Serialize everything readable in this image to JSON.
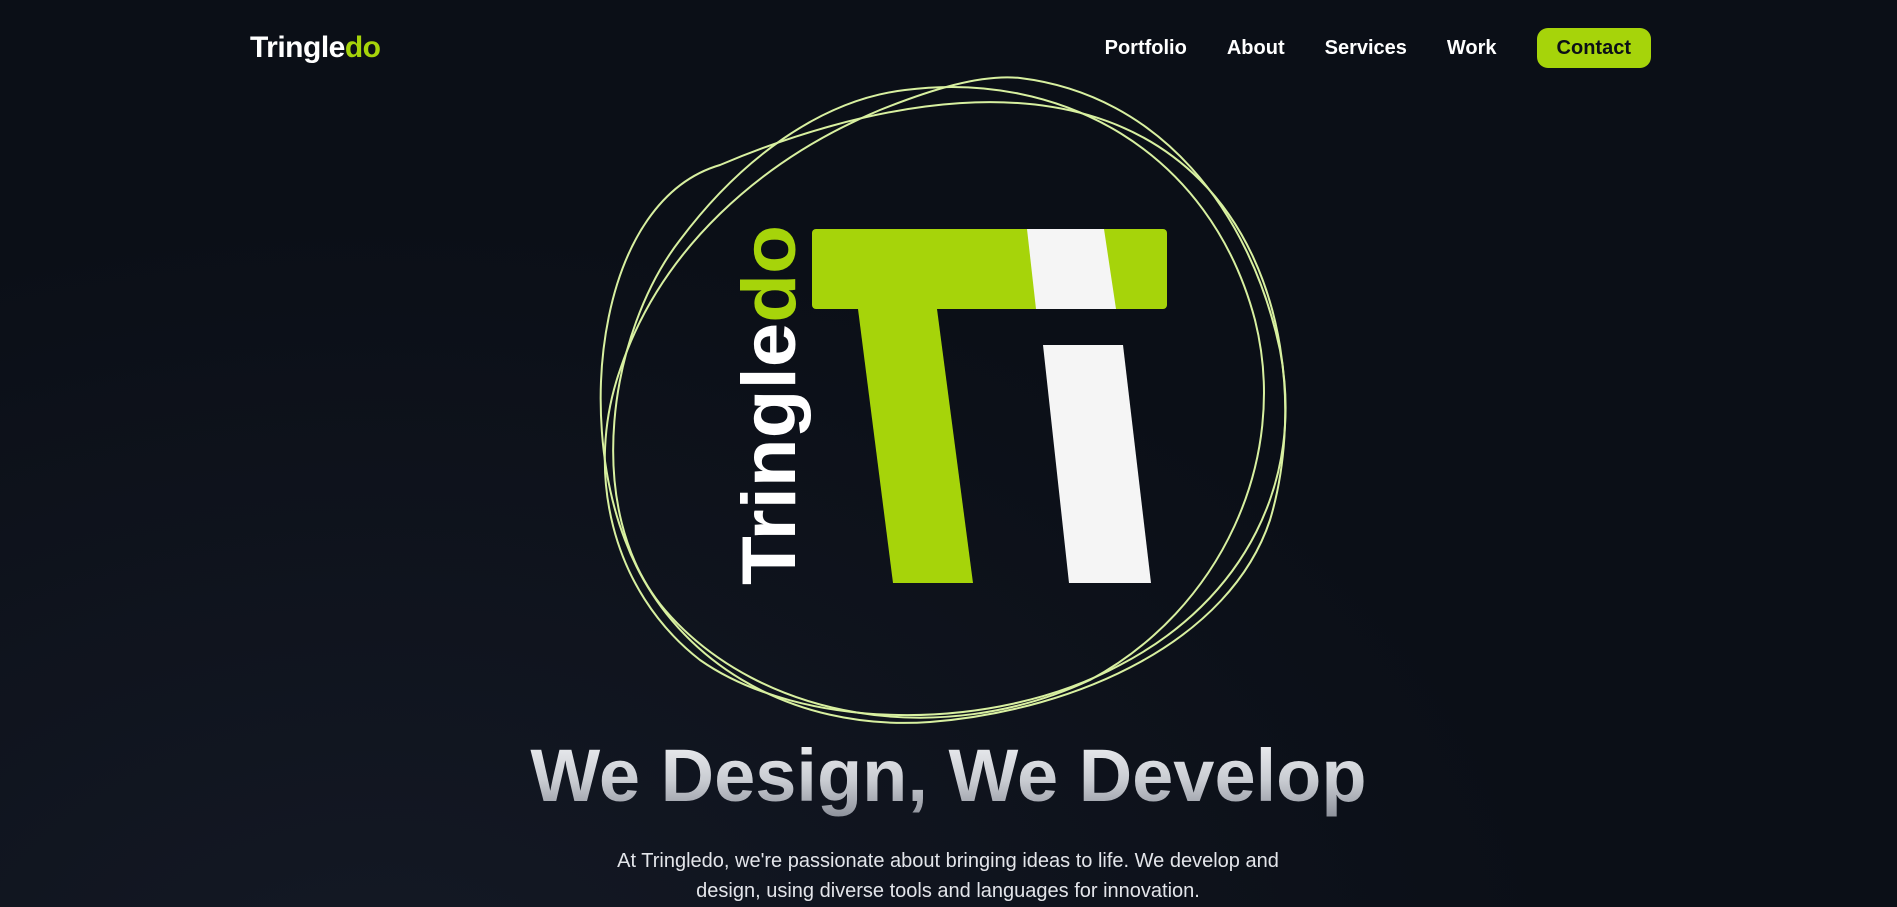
{
  "brand": {
    "part1": "Tringle",
    "part2": "do"
  },
  "nav": {
    "items": [
      {
        "label": "Portfolio"
      },
      {
        "label": "About"
      },
      {
        "label": "Services"
      },
      {
        "label": "Work"
      }
    ],
    "contact_label": "Contact"
  },
  "hero": {
    "logo_text_part1": "Tringle",
    "logo_text_part2": "do",
    "title": "We Design, We Develop",
    "description": "At Tringledo, we're passionate about bringing ideas to life. We develop and design, using diverse tools and languages for innovation."
  },
  "colors": {
    "accent": "#a6d40a",
    "background": "#0b0f17",
    "ring": "#d8f0a0",
    "white_block": "#f5f5f5"
  }
}
